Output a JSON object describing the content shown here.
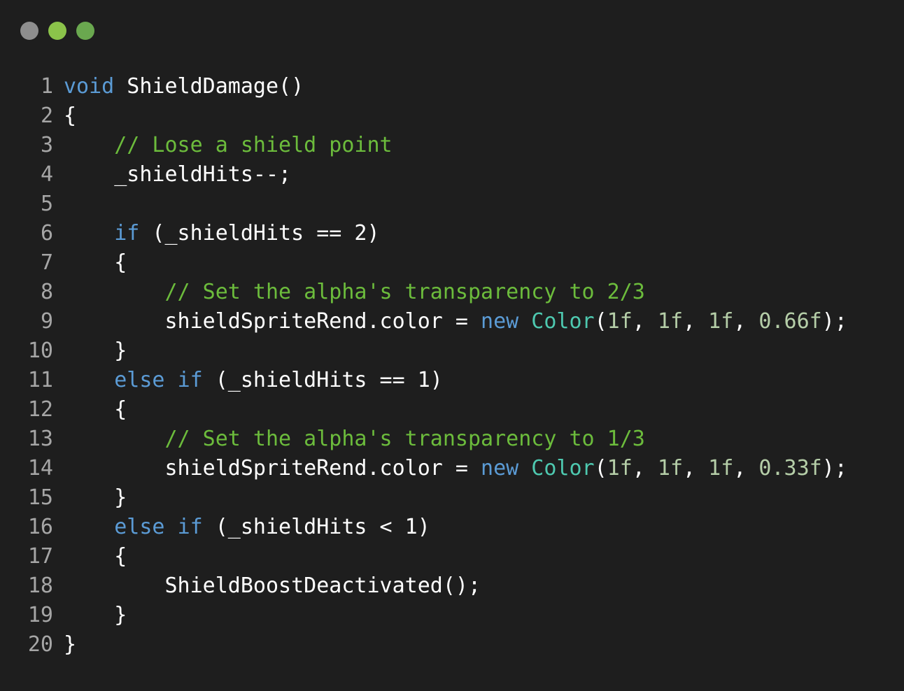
{
  "window": {
    "controls": [
      {
        "name": "close",
        "color": "#8e8e8e"
      },
      {
        "name": "minimize",
        "color": "#8bc34a"
      },
      {
        "name": "maximize",
        "color": "#6aa84f"
      }
    ]
  },
  "colors": {
    "background": "#1e1e1e",
    "line_number": "#a6a6a6",
    "text": "#ffffff",
    "keyword": "#5b9bd5",
    "comment": "#6cbc3c",
    "type": "#4ec9b0",
    "number": "#b5cea8"
  },
  "code": {
    "lines": [
      {
        "n": "1",
        "tokens": [
          {
            "t": "kw",
            "v": "void"
          },
          {
            "t": "tx",
            "v": " ShieldDamage()"
          }
        ]
      },
      {
        "n": "2",
        "tokens": [
          {
            "t": "tx",
            "v": "{"
          }
        ]
      },
      {
        "n": "3",
        "tokens": [
          {
            "t": "tx",
            "v": "    "
          },
          {
            "t": "cm",
            "v": "// Lose a shield point"
          }
        ]
      },
      {
        "n": "4",
        "tokens": [
          {
            "t": "tx",
            "v": "    _shieldHits--;"
          }
        ]
      },
      {
        "n": "5",
        "tokens": []
      },
      {
        "n": "6",
        "tokens": [
          {
            "t": "tx",
            "v": "    "
          },
          {
            "t": "kw",
            "v": "if"
          },
          {
            "t": "tx",
            "v": " (_shieldHits == 2)"
          }
        ]
      },
      {
        "n": "7",
        "tokens": [
          {
            "t": "tx",
            "v": "    {"
          }
        ]
      },
      {
        "n": "8",
        "tokens": [
          {
            "t": "tx",
            "v": "        "
          },
          {
            "t": "cm",
            "v": "// Set the alpha's transparency to 2/3"
          }
        ]
      },
      {
        "n": "9",
        "tokens": [
          {
            "t": "tx",
            "v": "        shieldSpriteRend.color = "
          },
          {
            "t": "kw",
            "v": "new"
          },
          {
            "t": "tx",
            "v": " "
          },
          {
            "t": "ty",
            "v": "Color"
          },
          {
            "t": "tx",
            "v": "("
          },
          {
            "t": "num",
            "v": "1f"
          },
          {
            "t": "tx",
            "v": ", "
          },
          {
            "t": "num",
            "v": "1f"
          },
          {
            "t": "tx",
            "v": ", "
          },
          {
            "t": "num",
            "v": "1f"
          },
          {
            "t": "tx",
            "v": ", "
          },
          {
            "t": "num",
            "v": "0.66f"
          },
          {
            "t": "tx",
            "v": ");"
          }
        ]
      },
      {
        "n": "10",
        "tokens": [
          {
            "t": "tx",
            "v": "    }"
          }
        ]
      },
      {
        "n": "11",
        "tokens": [
          {
            "t": "tx",
            "v": "    "
          },
          {
            "t": "kw",
            "v": "else"
          },
          {
            "t": "tx",
            "v": " "
          },
          {
            "t": "kw",
            "v": "if"
          },
          {
            "t": "tx",
            "v": " (_shieldHits == 1)"
          }
        ]
      },
      {
        "n": "12",
        "tokens": [
          {
            "t": "tx",
            "v": "    {"
          }
        ]
      },
      {
        "n": "13",
        "tokens": [
          {
            "t": "tx",
            "v": "        "
          },
          {
            "t": "cm",
            "v": "// Set the alpha's transparency to 1/3"
          }
        ]
      },
      {
        "n": "14",
        "tokens": [
          {
            "t": "tx",
            "v": "        shieldSpriteRend.color = "
          },
          {
            "t": "kw",
            "v": "new"
          },
          {
            "t": "tx",
            "v": " "
          },
          {
            "t": "ty",
            "v": "Color"
          },
          {
            "t": "tx",
            "v": "("
          },
          {
            "t": "num",
            "v": "1f"
          },
          {
            "t": "tx",
            "v": ", "
          },
          {
            "t": "num",
            "v": "1f"
          },
          {
            "t": "tx",
            "v": ", "
          },
          {
            "t": "num",
            "v": "1f"
          },
          {
            "t": "tx",
            "v": ", "
          },
          {
            "t": "num",
            "v": "0.33f"
          },
          {
            "t": "tx",
            "v": ");"
          }
        ]
      },
      {
        "n": "15",
        "tokens": [
          {
            "t": "tx",
            "v": "    }"
          }
        ]
      },
      {
        "n": "16",
        "tokens": [
          {
            "t": "tx",
            "v": "    "
          },
          {
            "t": "kw",
            "v": "else"
          },
          {
            "t": "tx",
            "v": " "
          },
          {
            "t": "kw",
            "v": "if"
          },
          {
            "t": "tx",
            "v": " (_shieldHits < 1)"
          }
        ]
      },
      {
        "n": "17",
        "tokens": [
          {
            "t": "tx",
            "v": "    {"
          }
        ]
      },
      {
        "n": "18",
        "tokens": [
          {
            "t": "tx",
            "v": "        ShieldBoostDeactivated();"
          }
        ]
      },
      {
        "n": "19",
        "tokens": [
          {
            "t": "tx",
            "v": "    }"
          }
        ]
      },
      {
        "n": "20",
        "tokens": [
          {
            "t": "tx",
            "v": "}"
          }
        ]
      }
    ]
  }
}
